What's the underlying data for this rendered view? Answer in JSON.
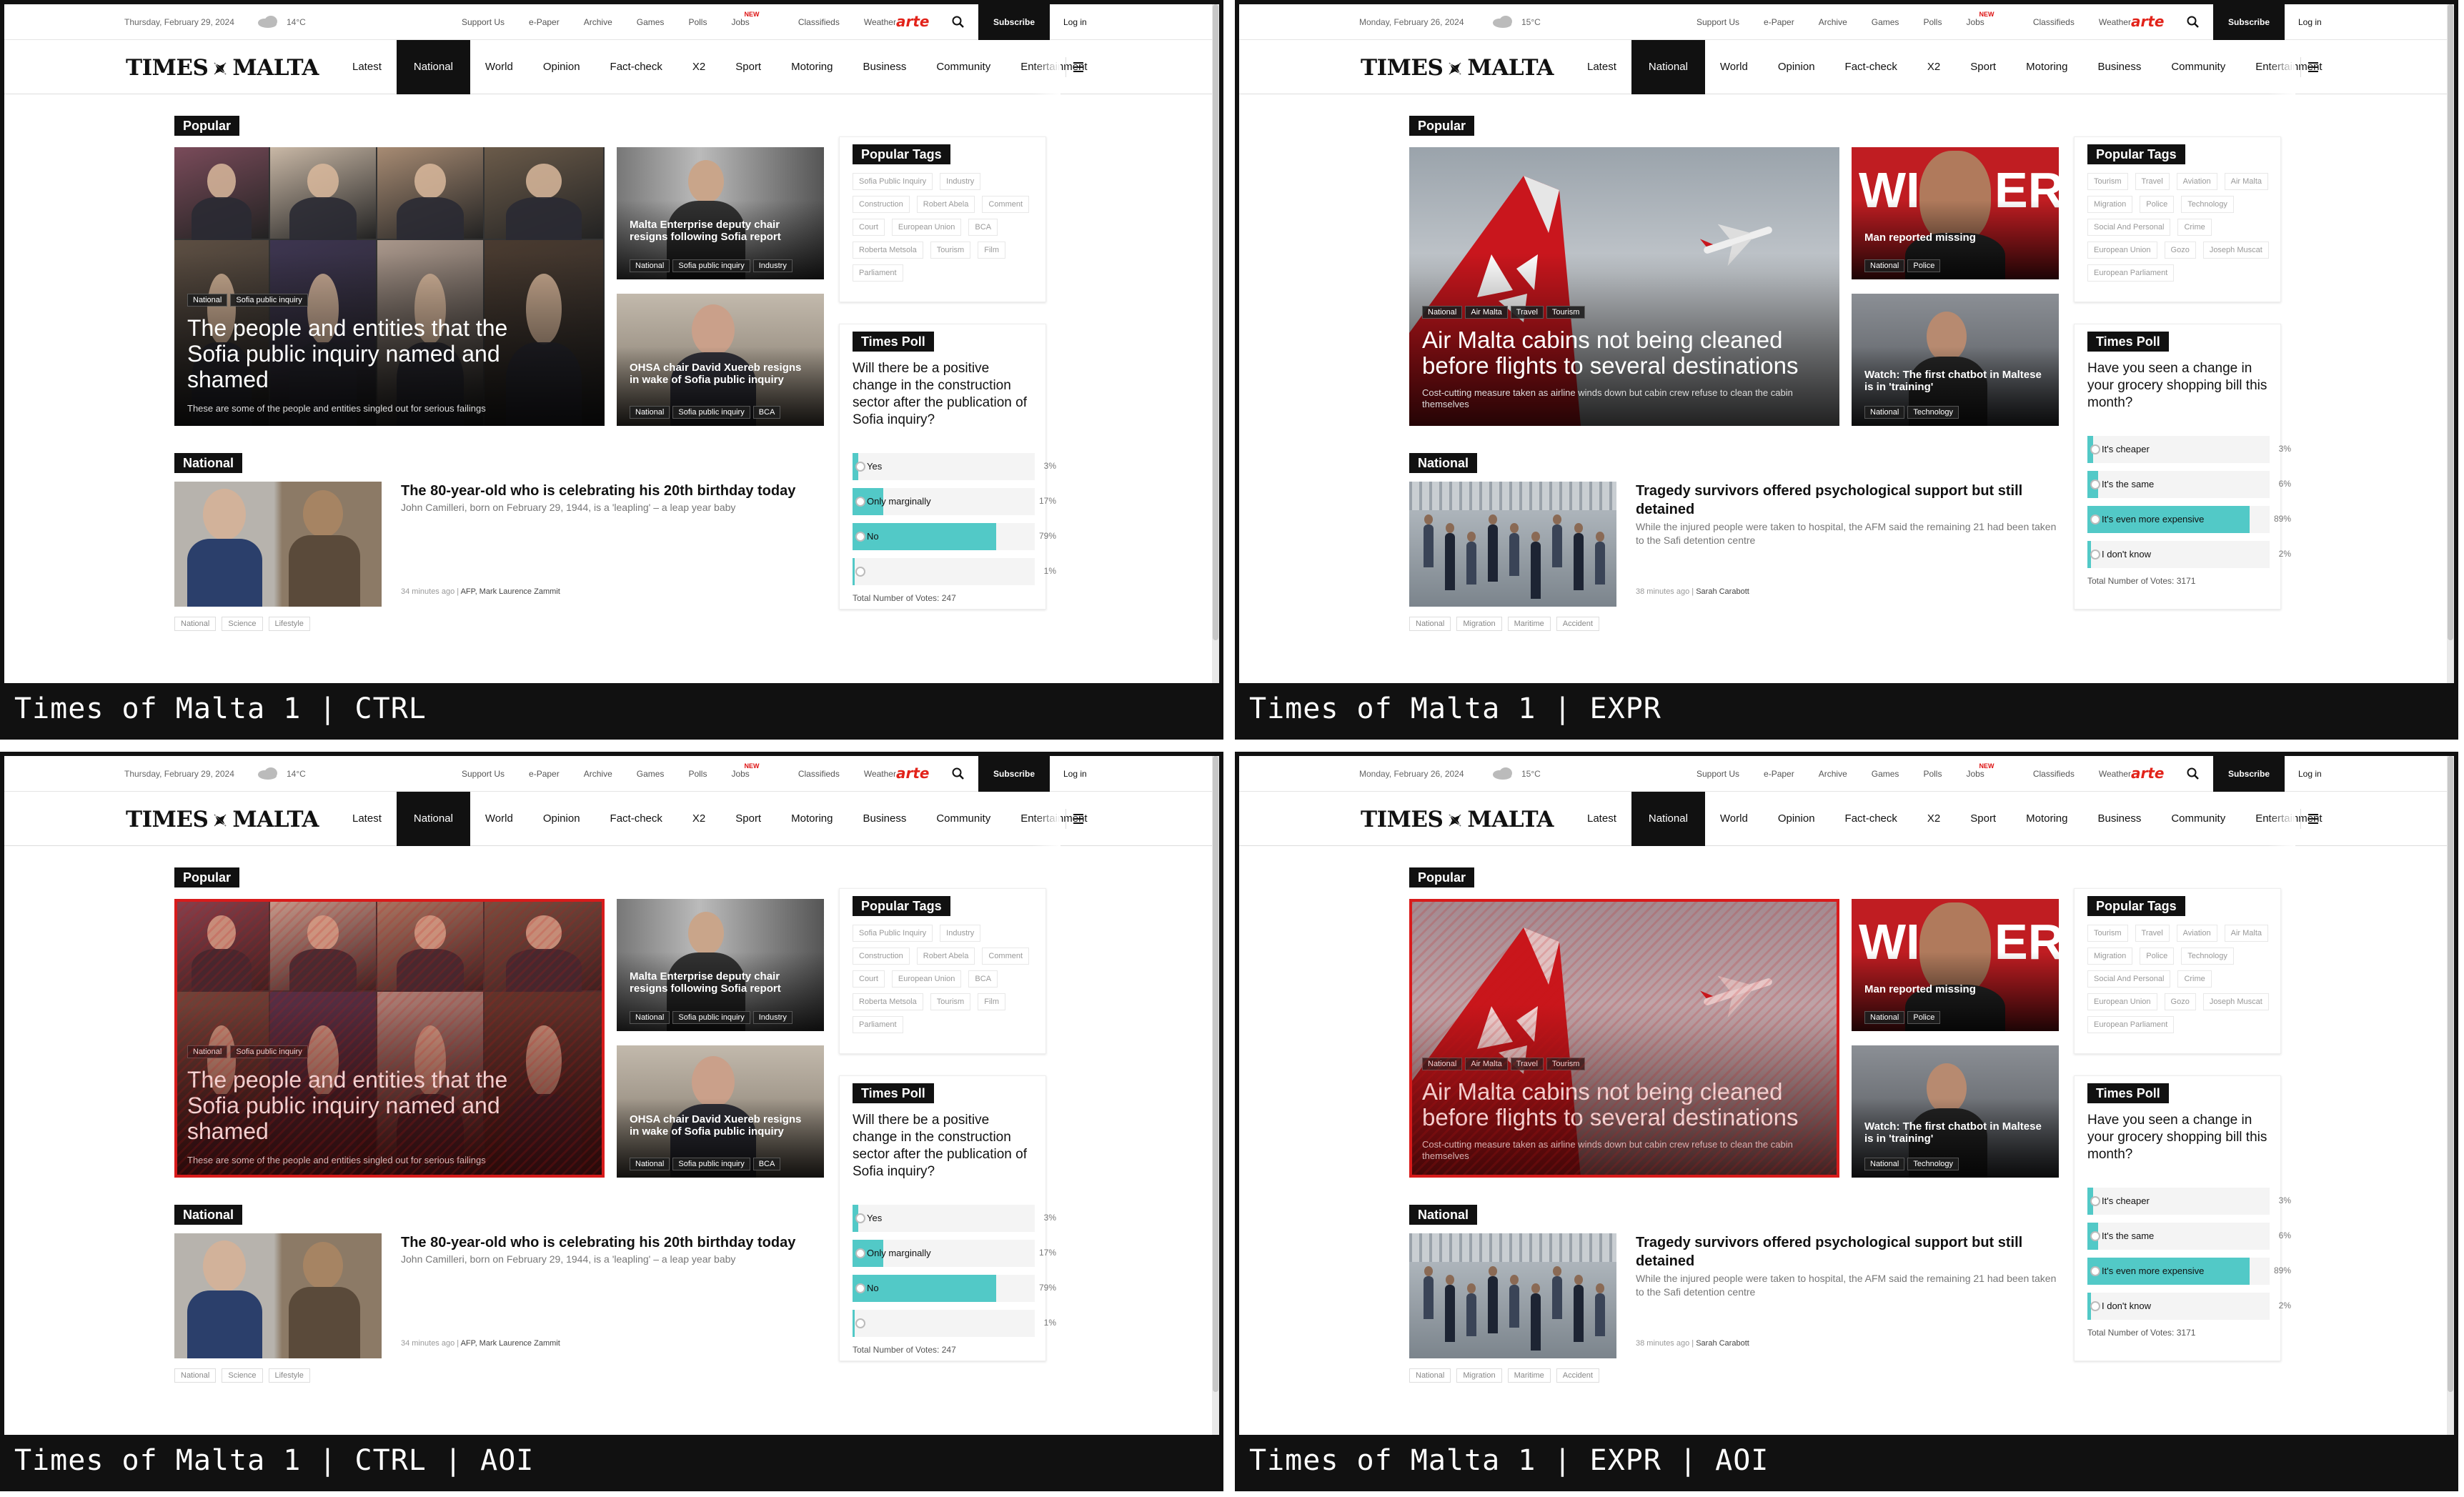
{
  "panels": [
    {
      "caption": "Times of Malta 1 | CTRL"
    },
    {
      "caption": "Times of Malta 1 | EXPR"
    },
    {
      "caption": "Times of Malta 1 | CTRL | AOI"
    },
    {
      "caption": "Times of Malta 1 | EXPR | AOI"
    }
  ],
  "ctrl": {
    "date": "Thursday, February 29, 2024",
    "temp": "14°C",
    "hero_tags": [
      "National",
      "Sofia public inquiry"
    ],
    "hero_title": "The people and entities that the Sofia public inquiry named and shamed",
    "hero_sub": "These are some of the people and entities singled out for serious failings",
    "side1_title": "Malta Enterprise deputy chair resigns following Sofia report",
    "side1_tags": [
      "National",
      "Sofia public inquiry",
      "Industry"
    ],
    "side2_title": "OHSA chair David Xuereb resigns in wake of Sofia public inquiry",
    "side2_tags": [
      "National",
      "Sofia public inquiry",
      "BCA"
    ],
    "nat_title": "The 80-year-old who is celebrating his 20th birthday today",
    "nat_sub": "John Camilleri, born on February 29, 1944, is a 'leapling' – a leap year baby",
    "nat_meta_time": "34 minutes ago |",
    "nat_meta_auth": "AFP, Mark Laurence Zammit",
    "nat_tags": [
      "National",
      "Science",
      "Lifestyle"
    ],
    "ptags": [
      "Sofia Public Inquiry",
      "Industry",
      "Construction",
      "Robert Abela",
      "Comment",
      "Court",
      "European Union",
      "BCA",
      "Roberta Metsola",
      "Tourism",
      "Film",
      "Parliament"
    ],
    "poll_q": "Will there be a positive change in the construction sector after the publication of Sofia inquiry?",
    "poll": [
      {
        "label": "Yes",
        "pct": "3%",
        "v": 3
      },
      {
        "label": "Only marginally",
        "pct": "17%",
        "v": 17
      },
      {
        "label": "No",
        "pct": "79%",
        "v": 79
      },
      {
        "label": "",
        "pct": "1%",
        "v": 1
      }
    ],
    "votes": "Total Number of Votes: 247"
  },
  "expr": {
    "date": "Monday, February 26, 2024",
    "temp": "15°C",
    "hero_tags": [
      "National",
      "Air Malta",
      "Travel",
      "Tourism"
    ],
    "hero_title": "Air Malta cabins not being cleaned before flights to several destinations",
    "hero_sub": "Cost-cutting measure taken as airline winds down but cabin crew refuse to clean the cabin themselves",
    "side1_title": "Man reported missing",
    "side1_tags": [
      "National",
      "Police"
    ],
    "side2_title": "Watch: The first chatbot in Maltese is in 'training'",
    "side2_tags": [
      "National",
      "Technology"
    ],
    "nat_title": "Tragedy survivors offered psychological support but still detained",
    "nat_sub": "While the injured people were taken to hospital, the AFM said the remaining 21 had been taken to the Safi detention centre",
    "nat_meta_time": "38 minutes ago |",
    "nat_meta_auth": "Sarah Carabott",
    "nat_tags": [
      "National",
      "Migration",
      "Maritime",
      "Accident"
    ],
    "ptags": [
      "Tourism",
      "Travel",
      "Aviation",
      "Air Malta",
      "Migration",
      "Police",
      "Technology",
      "Social And Personal",
      "Crime",
      "European Union",
      "Gozo",
      "Joseph Muscat",
      "European Parliament"
    ],
    "poll_q": "Have you seen a change in your grocery shopping bill this month?",
    "poll": [
      {
        "label": "It's cheaper",
        "pct": "3%",
        "v": 3
      },
      {
        "label": "It's the same",
        "pct": "6%",
        "v": 6
      },
      {
        "label": "It's even more expensive",
        "pct": "89%",
        "v": 89
      },
      {
        "label": "I don't know",
        "pct": "2%",
        "v": 2
      }
    ],
    "votes": "Total Number of Votes: 3171"
  },
  "common": {
    "top_links": [
      "Support Us",
      "e-Paper",
      "Archive",
      "Games",
      "Polls",
      "Jobs",
      "Classifieds",
      "Weather"
    ],
    "jobs_badge": "NEW",
    "arte": "arte",
    "subscribe": "Subscribe",
    "login": "Log in",
    "logo_left": "TIMES",
    "logo_right": "MALTA",
    "nav": [
      "Latest",
      "National",
      "World",
      "Opinion",
      "Fact-check",
      "X2",
      "Sport",
      "Motoring",
      "Business",
      "Community",
      "Entertainment"
    ],
    "popular": "Popular",
    "national": "National",
    "popular_tags": "Popular Tags",
    "times_poll": "Times Poll"
  },
  "colors": {
    "accent": "#52c9c7",
    "aoi": "#d81b1b",
    "arte": "#e2231a",
    "dark": "#111111"
  }
}
